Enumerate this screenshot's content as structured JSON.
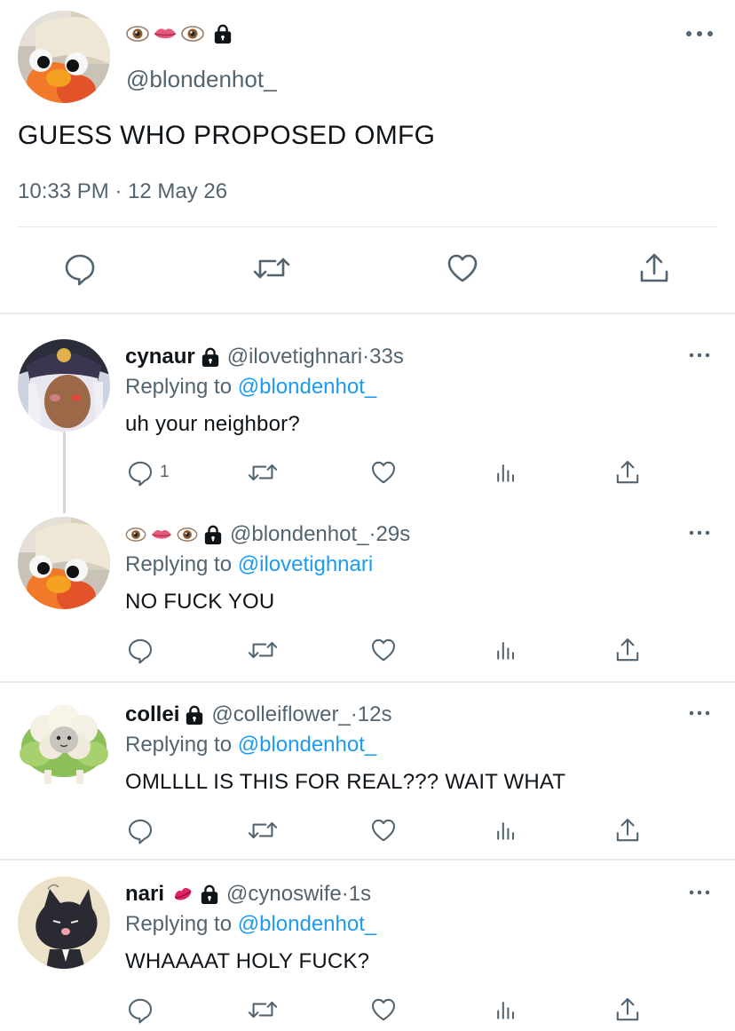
{
  "main_tweet": {
    "display_name": "👁️👄👁️",
    "handle": "@blondenhot_",
    "text": "GUESS WHO PROPOSED OMFG",
    "timestamp": "10:33 PM · 12 May 26"
  },
  "replies": [
    {
      "display_name": "cynaur",
      "handle": "@ilovetighnari",
      "time": "33s",
      "replying_label": "Replying to",
      "replying_to": "@blondenhot_",
      "text": "uh your neighbor?",
      "reply_count": "1"
    },
    {
      "display_name": "👁️👄👁️",
      "handle": "@blondenhot_",
      "time": "29s",
      "replying_label": "Replying to",
      "replying_to": "@ilovetighnari",
      "text": "NO FUCK YOU",
      "reply_count": ""
    },
    {
      "display_name": "collei",
      "handle": "@colleiflower_",
      "time": "12s",
      "replying_label": "Replying to",
      "replying_to": "@blondenhot_",
      "text": "OMLLLL IS THIS FOR REAL??? WAIT WHAT",
      "reply_count": ""
    },
    {
      "display_name": "nari",
      "handle": "@cynoswife",
      "time": "1s",
      "replying_label": "Replying to",
      "replying_to": "@blondenhot_",
      "text": "WHAAAAT HOLY FUCK?",
      "reply_count": ""
    }
  ],
  "separator": " · ",
  "icons": [
    "reply-icon",
    "retweet-icon",
    "like-icon",
    "analytics-icon",
    "share-icon",
    "more-icon",
    "lock-icon"
  ],
  "colors": {
    "accent": "#1d9bf0",
    "secondary_text": "#536471",
    "primary_text": "#0f1419"
  }
}
